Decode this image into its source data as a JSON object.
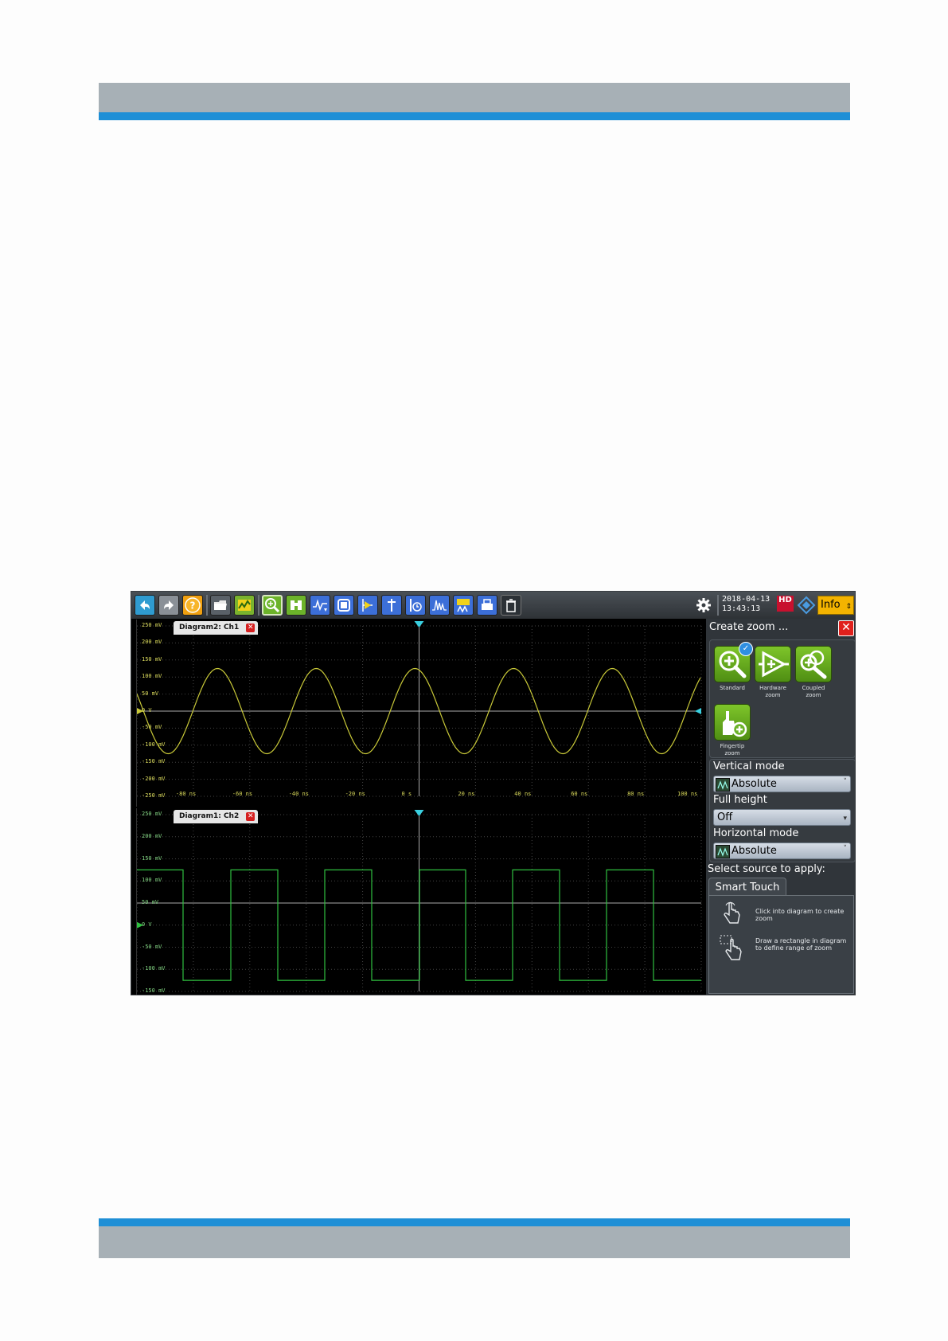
{
  "toolbar": {
    "clock_date": "2018-04-13",
    "clock_time": "13:43:13",
    "hd_label": "HD",
    "info_label": "Info"
  },
  "diagram_top": {
    "tab_label": "Diagram2: Ch1",
    "close_label": "✕",
    "y_ticks": [
      "250 mV",
      "200 mV",
      "150 mV",
      "100 mV",
      "50 mV",
      "0 V",
      "-50 mV",
      "-100 mV",
      "-150 mV",
      "-200 mV",
      "-250 mV"
    ],
    "x_ticks": [
      "-80 ns",
      "-60 ns",
      "-40 ns",
      "-20 ns",
      "0 s",
      "20 ns",
      "40 ns",
      "60 ns",
      "80 ns",
      "100 ns"
    ],
    "trace_color": "#c8c838"
  },
  "diagram_bottom": {
    "tab_label": "Diagram1: Ch2",
    "close_label": "✕",
    "y_ticks": [
      "250 mV",
      "200 mV",
      "150 mV",
      "100 mV",
      "50 mV",
      "0 V",
      "-50 mV",
      "-100 mV",
      "-150 mV"
    ],
    "trace_color": "#2fbf3f"
  },
  "side_panel": {
    "title": "Create zoom ...",
    "close_label": "✕",
    "zoom_buttons": [
      {
        "label_line1": "Standard",
        "label_line2": "",
        "icon": "magnifier-plus-icon",
        "selected": true
      },
      {
        "label_line1": "Hardware",
        "label_line2": "zoom",
        "icon": "hardware-zoom-icon"
      },
      {
        "label_line1": "Coupled",
        "label_line2": "zoom",
        "icon": "coupled-zoom-icon"
      },
      {
        "label_line1": "Fingertip",
        "label_line2": "zoom",
        "icon": "fingertip-zoom-icon"
      }
    ],
    "vertical_mode_label": "Vertical mode",
    "vertical_mode_value": "Absolute",
    "full_height_label": "Full height",
    "full_height_value": "Off",
    "horizontal_mode_label": "Horizontal mode",
    "horizontal_mode_value": "Absolute",
    "select_source_label": "Select source to apply:",
    "smart_touch_tab": "Smart Touch",
    "hints": [
      "Click into diagram to create zoom",
      "Draw a rectangle in diagram to define range of zoom"
    ],
    "check_mark": "✓"
  },
  "colors": {
    "brand_blue": "#1f8fd6",
    "header_gray": "#a7b0b6",
    "zoom_green": "#6cb32a",
    "info_yellow": "#f3b300"
  }
}
